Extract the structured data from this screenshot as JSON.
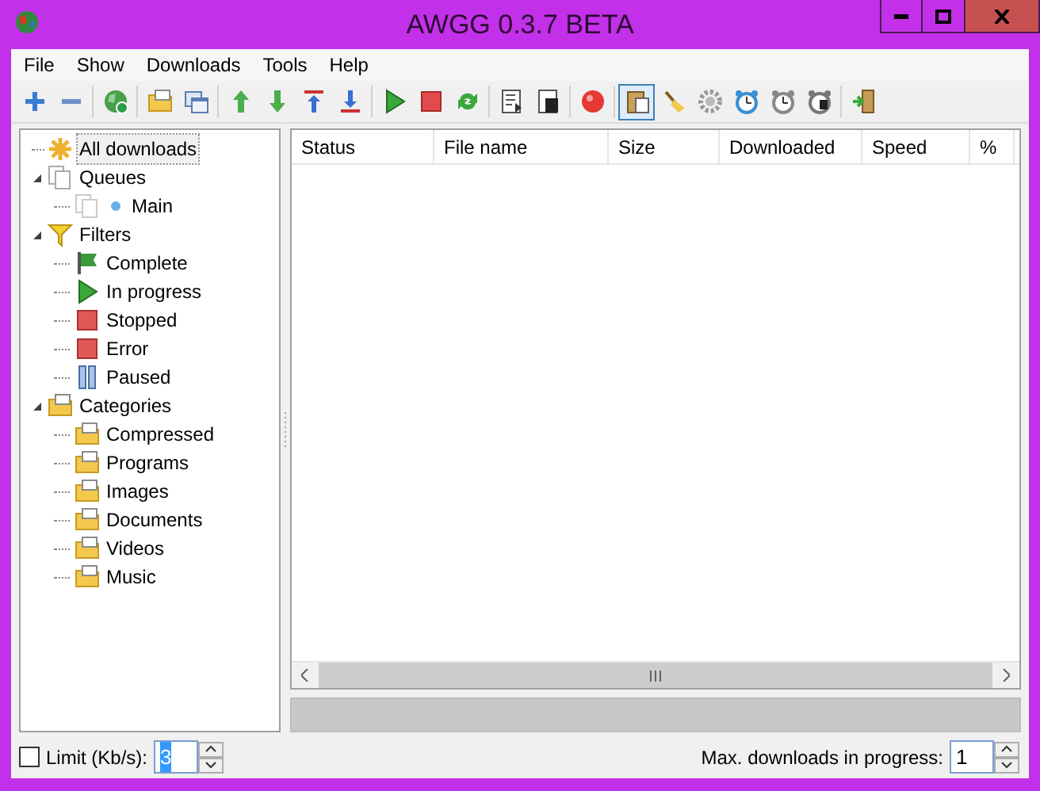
{
  "window": {
    "title": "AWGG 0.3.7 BETA"
  },
  "menu": [
    "File",
    "Show",
    "Downloads",
    "Tools",
    "Help"
  ],
  "toolbar": [
    [
      {
        "kind": "plus",
        "on": false
      },
      {
        "kind": "minus",
        "on": false
      }
    ],
    [
      {
        "kind": "globe",
        "on": false
      }
    ],
    [
      {
        "kind": "folder",
        "on": false
      },
      {
        "kind": "window",
        "on": false
      }
    ],
    [
      {
        "kind": "up",
        "on": false
      },
      {
        "kind": "down",
        "on": false
      },
      {
        "kind": "top",
        "on": false
      },
      {
        "kind": "bottom",
        "on": false
      }
    ],
    [
      {
        "kind": "play",
        "on": false
      },
      {
        "kind": "stop",
        "on": false
      },
      {
        "kind": "refresh",
        "on": false
      }
    ],
    [
      {
        "kind": "document",
        "on": false
      },
      {
        "kind": "document-dark",
        "on": false
      }
    ],
    [
      {
        "kind": "record",
        "on": false
      }
    ],
    [
      {
        "kind": "clipboard",
        "on": true
      },
      {
        "kind": "broom",
        "on": false
      },
      {
        "kind": "gear",
        "on": false
      },
      {
        "kind": "alarm",
        "on": false
      },
      {
        "kind": "clock",
        "on": false
      },
      {
        "kind": "clock-dark",
        "on": false
      }
    ],
    [
      {
        "kind": "exit",
        "on": false
      }
    ]
  ],
  "tree": [
    {
      "label": "All downloads",
      "kind": "star",
      "selected": true
    },
    {
      "label": "Queues",
      "kind": "pages",
      "selected": false,
      "expanded": true,
      "children": [
        {
          "label": "Main",
          "kind": "queue",
          "selected": false
        }
      ]
    },
    {
      "label": "Filters",
      "kind": "funnel",
      "selected": false,
      "expanded": true,
      "children": [
        {
          "label": "Complete",
          "kind": "flag",
          "selected": false
        },
        {
          "label": "In progress",
          "kind": "play",
          "selected": false
        },
        {
          "label": "Stopped",
          "kind": "square",
          "selected": false
        },
        {
          "label": "Error",
          "kind": "square",
          "selected": false
        },
        {
          "label": "Paused",
          "kind": "pause",
          "selected": false
        }
      ]
    },
    {
      "label": "Categories",
      "kind": "folder",
      "selected": false,
      "expanded": true,
      "children": [
        {
          "label": "Compressed",
          "kind": "folder",
          "selected": false
        },
        {
          "label": "Programs",
          "kind": "folder",
          "selected": false
        },
        {
          "label": "Images",
          "kind": "folder",
          "selected": false
        },
        {
          "label": "Documents",
          "kind": "folder",
          "selected": false
        },
        {
          "label": "Videos",
          "kind": "folder",
          "selected": false
        },
        {
          "label": "Music",
          "kind": "folder",
          "selected": false
        }
      ]
    }
  ],
  "progress": {
    "level": 0
  },
  "table": {
    "columns": [
      "Status",
      "File name",
      "Size",
      "Downloaded",
      "Speed",
      "%"
    ]
  },
  "bottom": {
    "limit_label": "Limit (Kb/s):",
    "limit_checked": false,
    "limit_value": "3",
    "max_label": "Max. downloads in progress:",
    "max_value": "1"
  }
}
